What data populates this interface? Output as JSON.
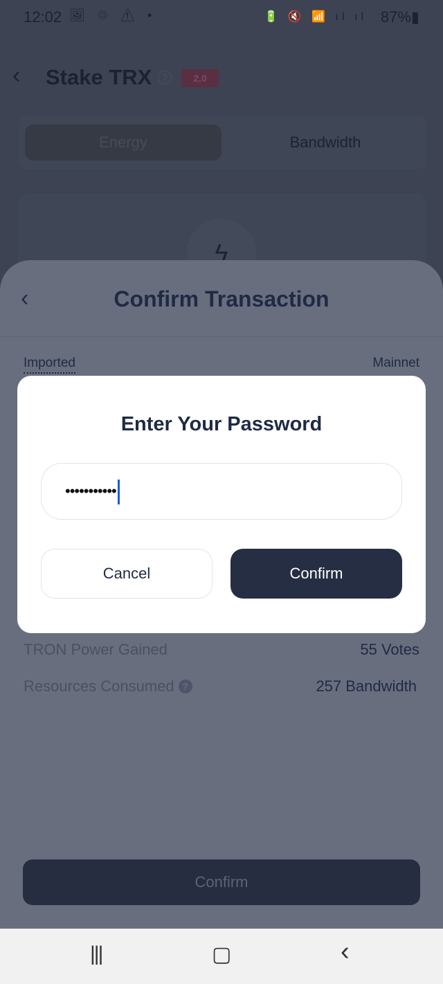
{
  "status_bar": {
    "time": "12:02",
    "left_icons": "🖼 ♲ ⚠ •",
    "right_icons": "🔋 🔇 📶 ıl ıl",
    "battery": "87%▮"
  },
  "background": {
    "back": "‹",
    "title": "Stake TRX",
    "help": "?",
    "badge": "2.0",
    "tabs": [
      "Energy",
      "Bandwidth"
    ],
    "bolt": "ϟ"
  },
  "sheet": {
    "back": "‹",
    "title": "Confirm Transaction",
    "account": "Imported",
    "network": "Mainnet",
    "rows": [
      {
        "label": "TRON Power Gained",
        "value": "55 Votes"
      },
      {
        "label": "Resources Consumed",
        "value": "257 Bandwidth",
        "help": "?"
      }
    ],
    "confirm": "Confirm"
  },
  "dialog": {
    "title": "Enter Your Password",
    "password_value": "•••••••••••",
    "cancel": "Cancel",
    "confirm": "Confirm"
  },
  "navbar": {
    "recents": "|||",
    "home": "▢",
    "back": "‹"
  }
}
